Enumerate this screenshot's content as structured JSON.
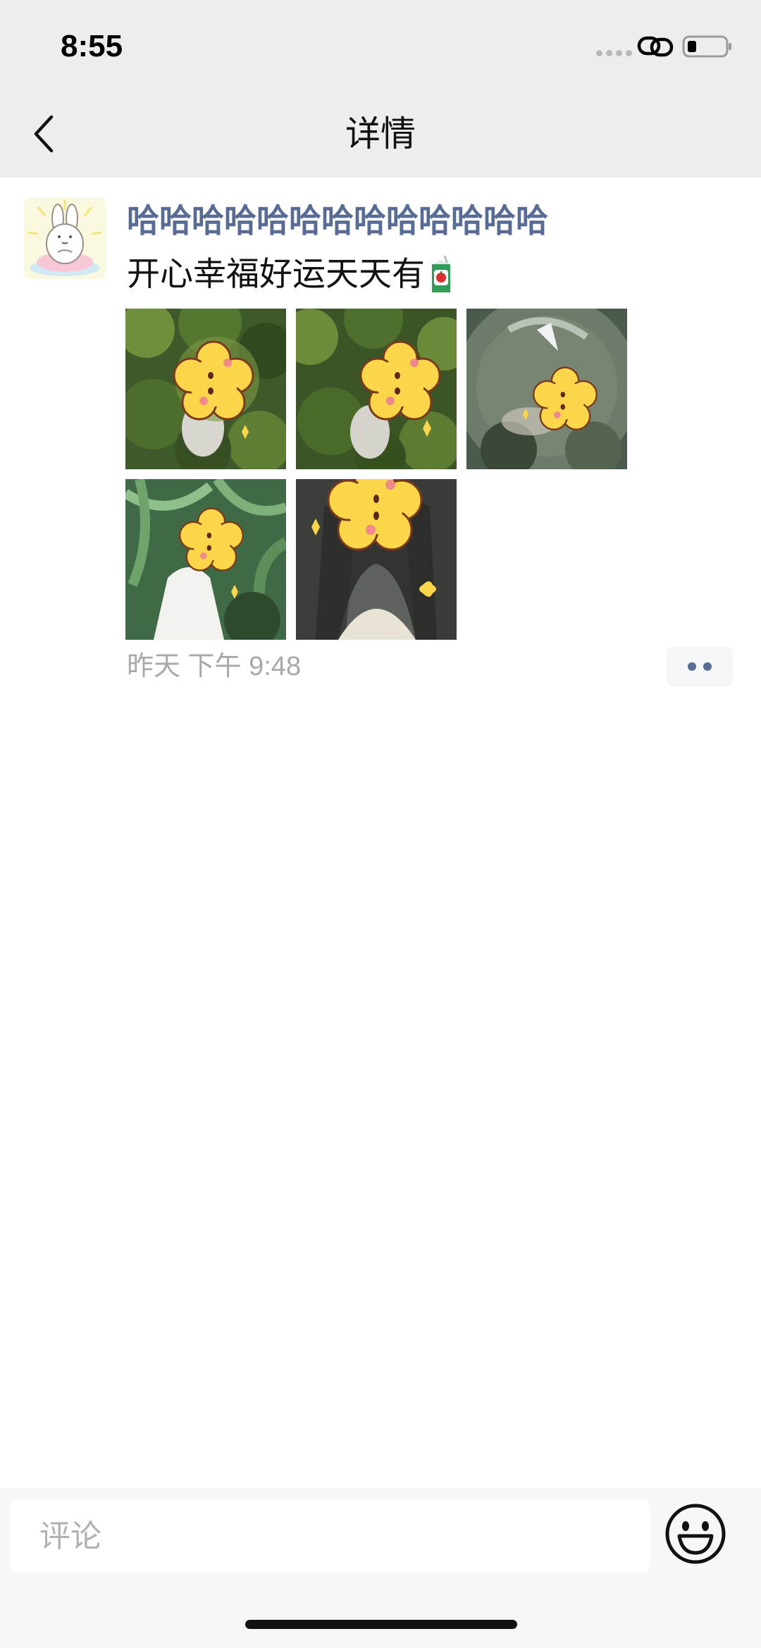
{
  "status_bar": {
    "time": "8:55",
    "icons": [
      "signal-dots-icon",
      "link-icon",
      "battery-icon"
    ]
  },
  "nav": {
    "back_icon": "chevron-left-icon",
    "title": "详情"
  },
  "post": {
    "avatar_icon": "bunny-avatar",
    "author": "哈哈哈哈哈哈哈哈哈哈哈哈哈",
    "text": "开心幸福好运天天有",
    "emoji_icon": "juice-box-icon",
    "photos": [
      {
        "name": "photo-forest-1"
      },
      {
        "name": "photo-forest-2"
      },
      {
        "name": "photo-bubble"
      },
      {
        "name": "photo-palm-girl"
      },
      {
        "name": "photo-portrait"
      }
    ],
    "time": "昨天  下午 9:48",
    "more_icon": "more-dots-icon"
  },
  "comment_bar": {
    "placeholder": "评论",
    "emoji_icon": "smiley-icon"
  },
  "colors": {
    "name_blue": "#576b95",
    "nav_bg": "#ededed",
    "time_gray": "#a8a8a8",
    "sticker_yellow": "#fbd54a"
  }
}
